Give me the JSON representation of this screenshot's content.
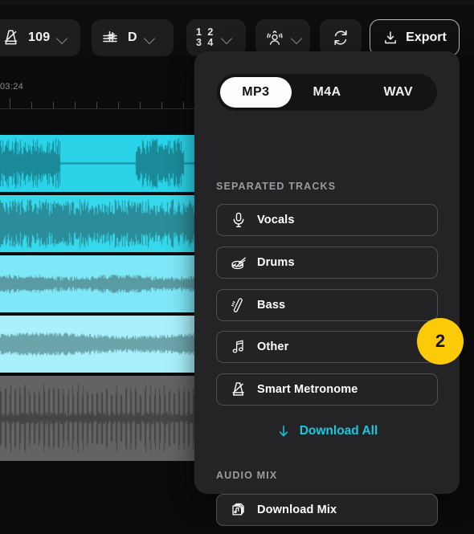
{
  "toolbar": {
    "tempo": {
      "icon": "metronome-icon",
      "value": "109",
      "chevron": "chevron-down-icon"
    },
    "key": {
      "icon": "key-signature-icon",
      "value": "D",
      "chevron": "chevron-down-icon"
    },
    "meter": {
      "icon": "time-signature-icon",
      "top": "1 2",
      "bottom": "3 4",
      "chevron": "chevron-down-icon"
    },
    "voice": {
      "icon": "vocal-guide-icon",
      "chevron": "chevron-down-icon"
    },
    "loop": {
      "icon": "loop-icon"
    },
    "export": {
      "icon": "download-icon",
      "label": "Export"
    }
  },
  "timeline": {
    "time_label": "03:24",
    "tracks": [
      {
        "name": "vocals-track",
        "bg": "#2ad3e8",
        "wave": "#1b8a98",
        "style": "vocal"
      },
      {
        "name": "drums-track",
        "bg": "#36d8ec",
        "wave": "#2a8d99",
        "style": "drums"
      },
      {
        "name": "bass-track",
        "bg": "#7fe8f8",
        "wave": "#5a9aa2",
        "style": "bass"
      },
      {
        "name": "other-track",
        "bg": "#a8f0fb",
        "wave": "#6ba5ab",
        "style": "other"
      },
      {
        "name": "metronome-track",
        "bg": "#636366",
        "wave": "#454547",
        "style": "metro"
      }
    ]
  },
  "panel": {
    "formats": [
      {
        "label": "MP3",
        "selected": true
      },
      {
        "label": "M4A",
        "selected": false
      },
      {
        "label": "WAV",
        "selected": false
      }
    ],
    "separated_tracks_label": "SEPARATED TRACKS",
    "tracks": [
      {
        "icon": "microphone-icon",
        "label": "Vocals"
      },
      {
        "icon": "snare-drum-icon",
        "label": "Drums"
      },
      {
        "icon": "bass-guitar-icon",
        "label": "Bass"
      },
      {
        "icon": "music-notes-icon",
        "label": "Other"
      },
      {
        "icon": "metronome-icon",
        "label": "Smart Metronome"
      }
    ],
    "badge": {
      "value": "2",
      "color": "#fbca08"
    },
    "download_all": {
      "icon": "arrow-down-icon",
      "label": "Download All",
      "color": "#19c8e0"
    },
    "audio_mix_label": "AUDIO MIX",
    "mix": {
      "icon": "file-stack-music-icon",
      "label": "Download Mix"
    }
  }
}
